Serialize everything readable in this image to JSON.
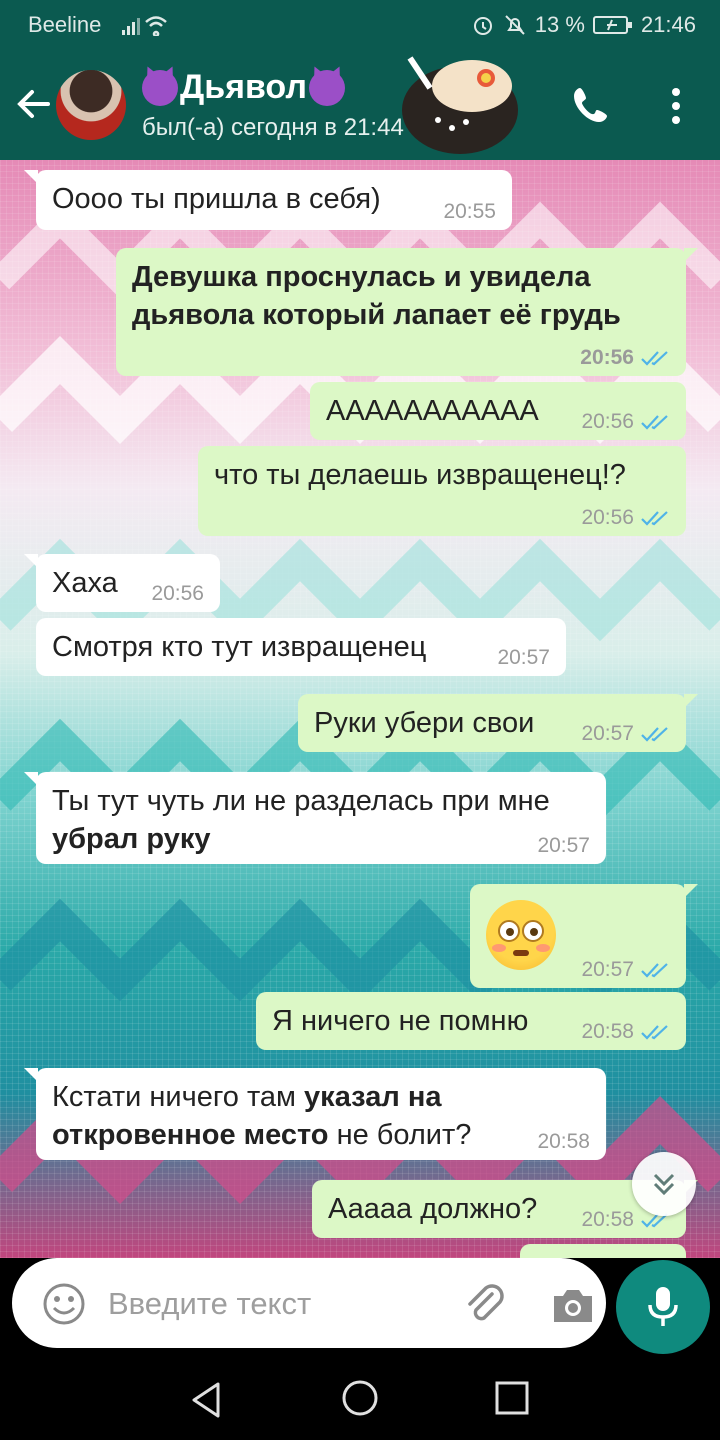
{
  "status_bar": {
    "carrier": "Beeline",
    "battery": "13 %",
    "time": "21:46"
  },
  "header": {
    "contact_name": "Дьявол",
    "last_seen": "был(-а) сегодня в 21:44",
    "icons": [
      "back-arrow-icon",
      "phone-icon",
      "more-vert-icon"
    ]
  },
  "messages": [
    {
      "dir": "in",
      "text": "Oooo ты пришла в себя)",
      "time": "20:55"
    },
    {
      "dir": "out",
      "text": "Девушка проснулась и увидела дьявола который лапает её грудь",
      "time": "20:56",
      "bold": true
    },
    {
      "dir": "out",
      "text": "ААААААААААА",
      "time": "20:56"
    },
    {
      "dir": "out",
      "text": "что ты делаешь извращенец!?",
      "time": "20:56"
    },
    {
      "dir": "in",
      "text": "Хаха",
      "time": "20:56"
    },
    {
      "dir": "in",
      "text": "Смотря кто тут извращенец",
      "time": "20:57"
    },
    {
      "dir": "out",
      "text": "Руки убери свои",
      "time": "20:57"
    },
    {
      "dir": "in",
      "text_plain": "Ты тут чуть ли не разделась при мне ",
      "text_bold": "убрал руку",
      "time": "20:57"
    },
    {
      "dir": "out",
      "emoji": "flushed-face",
      "time": "20:57"
    },
    {
      "dir": "out",
      "text": "Я ничего не помню",
      "time": "20:58"
    },
    {
      "dir": "in",
      "text_plain_1": "Кстати ничего там ",
      "text_bold_1": "указал на откровенное место",
      "text_plain_2": " не болит?",
      "time": "20:58"
    },
    {
      "dir": "out",
      "text": "Ааааа должно?",
      "time": "20:58"
    }
  ],
  "input": {
    "placeholder": "Введите текст"
  },
  "colors": {
    "header": "#0b5a50",
    "incoming_bubble": "#ffffff",
    "outgoing_bubble": "#dcf8c6",
    "read_ticks": "#4fb3e8",
    "mic_button": "#0f8a7e"
  }
}
